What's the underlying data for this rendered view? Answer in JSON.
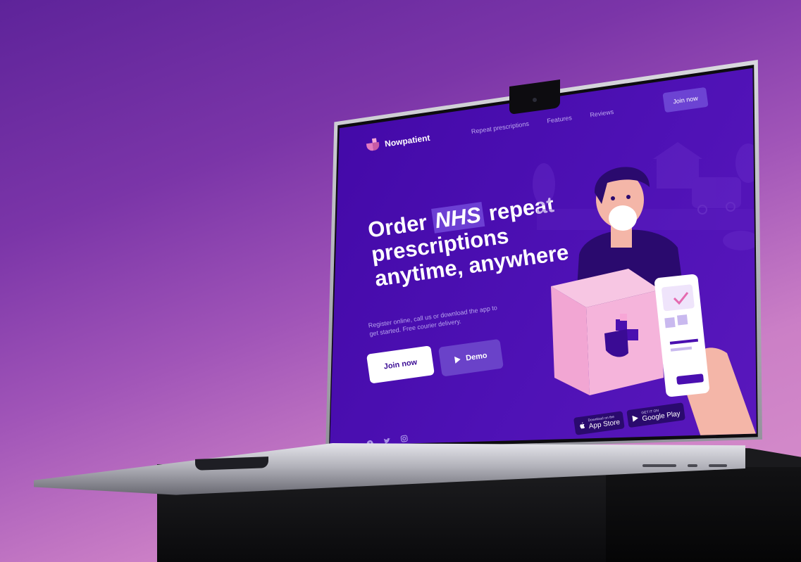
{
  "brand": {
    "name": "Nowpatient"
  },
  "nav": {
    "links": [
      "Repeat prescriptions",
      "Features",
      "Reviews"
    ],
    "join_label": "Join now"
  },
  "hero": {
    "title_prefix": "Order",
    "title_highlight": "NHS",
    "title_suffix": "repeat prescriptions anytime, anywhere",
    "subtitle": "Register online, call us or download the app to get started. Free courier delivery.",
    "join_label": "Join now",
    "demo_label": "Demo"
  },
  "store": {
    "apple_small": "Download on the",
    "apple_big": "App Store",
    "google_small": "GET IT ON",
    "google_big": "Google Play"
  },
  "social_icons": [
    "facebook-icon",
    "twitter-icon",
    "instagram-icon"
  ],
  "colors": {
    "screen_bg": "#4a0fb0",
    "accent": "#6c43d3",
    "pink": "#f7a6d6",
    "background_top": "#5e239a",
    "background_bottom": "#d991cc"
  }
}
